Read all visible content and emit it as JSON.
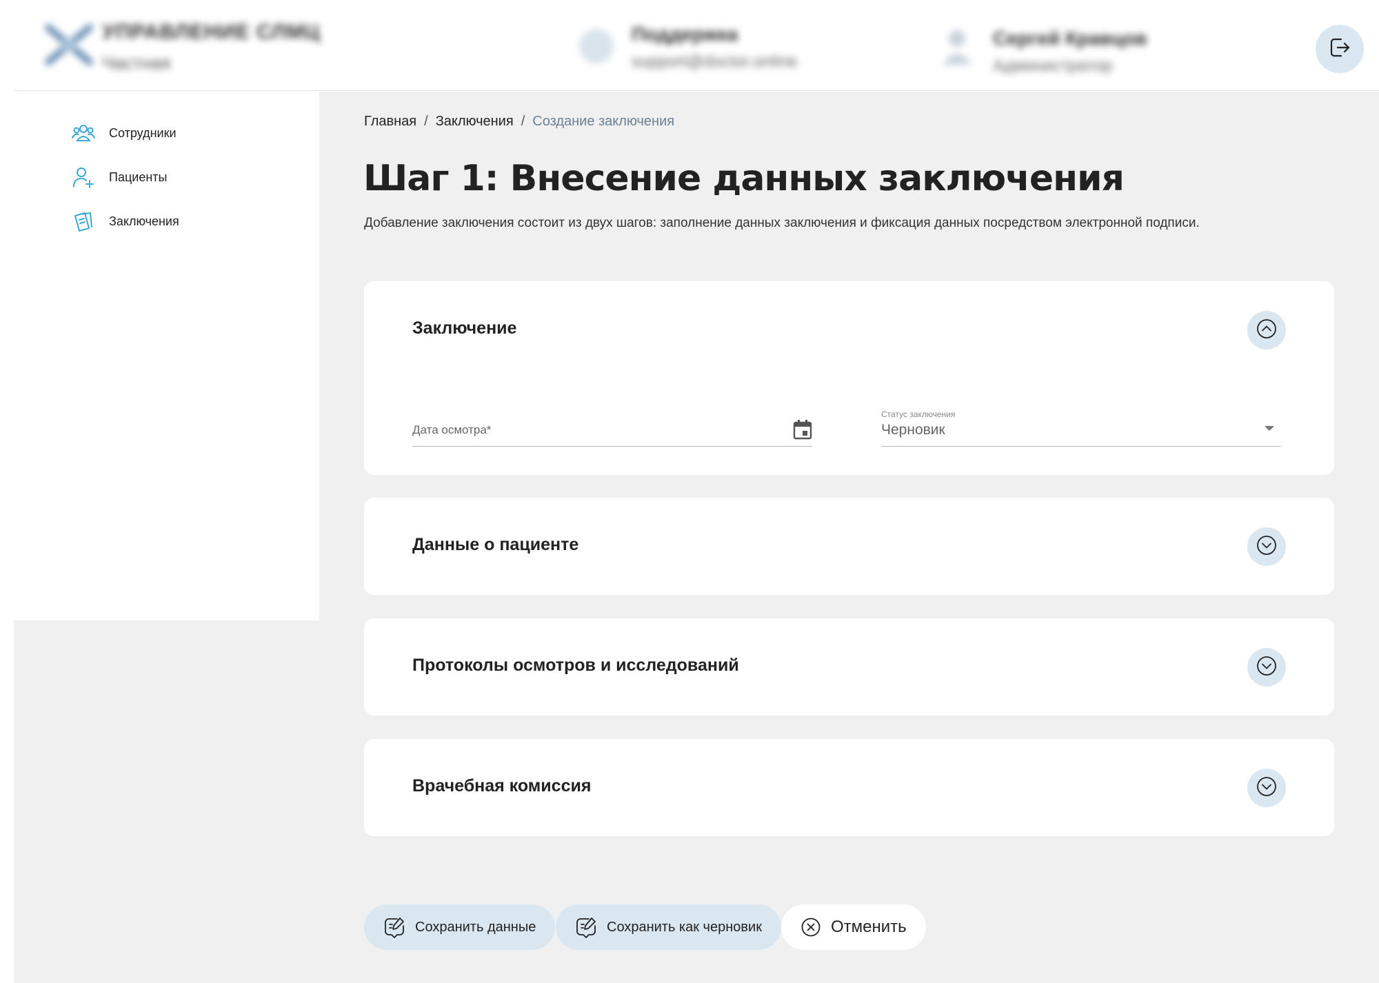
{
  "header": {
    "org_name": "УПРАВЛЕНИЕ СЛМЦ",
    "org_sub": "Частная",
    "support_title": "Поддержка",
    "support_email": "support@doctor.online",
    "user_name": "Сергей Кравцов",
    "user_role": "Администратор"
  },
  "sidebar": {
    "items": [
      {
        "label": "Сотрудники",
        "icon": "users-icon"
      },
      {
        "label": "Пациенты",
        "icon": "user-plus-icon"
      },
      {
        "label": "Заключения",
        "icon": "documents-icon"
      }
    ]
  },
  "breadcrumb": {
    "home": "Главная",
    "section": "Заключения",
    "current": "Создание заключения",
    "separator": "/"
  },
  "page": {
    "title": "Шаг 1: Внесение данных заключения",
    "subtitle": "Добавление заключения состоит из двух шагов: заполнение данных заключения и фиксация данных посредством электронной подписи."
  },
  "sections": {
    "conclusion": {
      "title": "Заключение",
      "expanded": true,
      "exam_date_placeholder": "Дата осмотра*",
      "status_label": "Статус заключения",
      "status_value": "Черновик"
    },
    "patient": {
      "title": "Данные о пациенте",
      "expanded": false
    },
    "protocols": {
      "title": "Протоколы осмотров и исследований",
      "expanded": false
    },
    "commission": {
      "title": "Врачебная комиссия",
      "expanded": false
    }
  },
  "actions": {
    "save": "Сохранить данные",
    "save_draft": "Сохранить как черновик",
    "cancel": "Отменить"
  },
  "colors": {
    "accent_icon": "#2a9fd6",
    "toggle_bg": "#dbe7f0",
    "page_bg": "#f0f0f0",
    "breadcrumb_current": "#6b7f95"
  }
}
